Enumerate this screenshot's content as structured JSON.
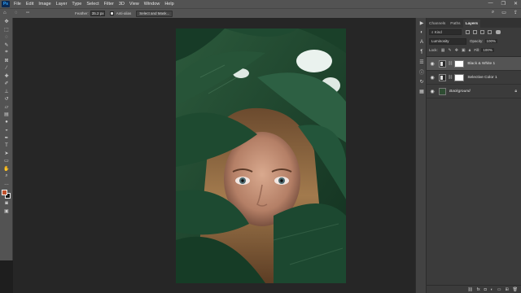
{
  "menubar": {
    "logo": "Ps",
    "items": [
      "File",
      "Edit",
      "Image",
      "Layer",
      "Type",
      "Select",
      "Filter",
      "3D",
      "View",
      "Window",
      "Help"
    ],
    "window_controls": [
      "—",
      "❐",
      "✕"
    ]
  },
  "options": {
    "feather_label": "Feather:",
    "feather_value": "35.2 px",
    "anti_alias_label": "Anti-alias",
    "select_mask_button": "Select and Mask..."
  },
  "right_panel": {
    "tabs": [
      "Channels",
      "Paths",
      "Layers"
    ],
    "active_tab": "Layers",
    "filter_kind": "Kind",
    "blend_mode": "Luminosity",
    "opacity_label": "Opacity:",
    "opacity_value": "100%",
    "lock_label": "Lock:",
    "fill_label": "Fill:",
    "fill_value": "100%",
    "layers": [
      {
        "name": "Black & White 1",
        "type": "adjustment",
        "selected": true
      },
      {
        "name": "Selective Color 1",
        "type": "adjustment",
        "selected": false
      },
      {
        "name": "Background",
        "type": "background",
        "selected": false
      }
    ]
  },
  "colors": {
    "foreground": "#c0512c",
    "background": "#1a1a1a",
    "accent": "#31a8ff"
  }
}
